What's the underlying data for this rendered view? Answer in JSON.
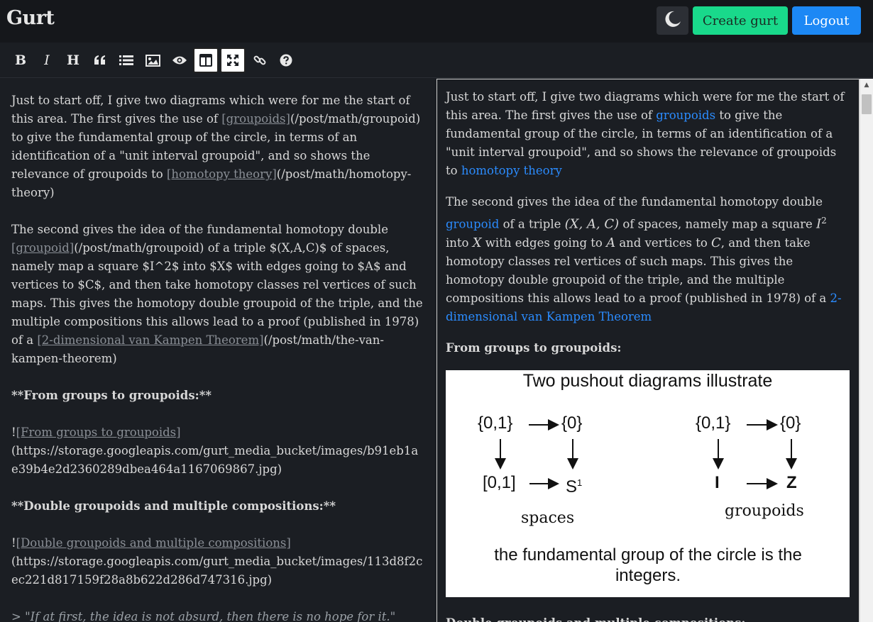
{
  "app": {
    "title": "Gurt"
  },
  "header": {
    "theme_icon": "moon-icon",
    "create_label": "Create gurt",
    "logout_label": "Logout",
    "colors": {
      "create": "#19d98b",
      "logout": "#1c88f5",
      "background": "#15171b"
    }
  },
  "toolbar": {
    "bold": "B",
    "italic": "I",
    "heading": "H",
    "items": [
      "bold",
      "italic",
      "heading",
      "quote",
      "unordered-list",
      "image",
      "preview",
      "side-by-side",
      "fullscreen",
      "link",
      "help"
    ],
    "active": [
      "side-by-side",
      "fullscreen"
    ]
  },
  "editor": {
    "p1_a": "Just to start off, I give two diagrams which were for me the start of this area. The first gives the use of ",
    "p1_link1": "[groupoids]",
    "p1_url1": "(/post/math/groupoid)",
    "p1_b": " to give the fundamental group of the circle, in terms of an identification of a \"unit interval groupoid\", and so shows the relevance of groupoids to ",
    "p1_link2": "[homotopy theory]",
    "p1_url2": "(/post/math/homotopy-theory)",
    "p2_a": "The second gives the idea of the fundamental homotopy double ",
    "p2_link1": "[groupoid]",
    "p2_url1": "(/post/math/groupoid)",
    "p2_b": " of a triple $(X,A,C)$ of spaces, namely map a square $I^2$ into $X$ with edges going to $A$ and vertices to $C$, and then take homotopy classes rel vertices of such maps. This gives the homotopy double groupoid of the triple, and the multiple compositions this allows lead to a proof (published in 1978) of a ",
    "p2_link2": "[2-dimensional van Kampen Theorem]",
    "p2_url2": "(/post/math/the-van-kampen-theorem)",
    "h1": "**From groups to groupoids:**",
    "img1_bang": "!",
    "img1_alt": "[From groups to groupoids]",
    "img1_url": "(https://storage.googleapis.com/gurt_media_bucket/images/b91eb1ae39b4e2d2360289dbea464a1167069867.jpg)",
    "h2": "**Double groupoids and multiple compositions:**",
    "img2_bang": "!",
    "img2_alt": "[Double groupoids and multiple compositions]",
    "img2_url": "(https://storage.googleapis.com/gurt_media_bucket/images/113d8f2cec221d817159f28a8b622d286d747316.jpg)",
    "quote": "> \"If at first, the idea is not absurd, then there is no hope for it.\" Albert Einstein"
  },
  "preview": {
    "p1_a": "Just to start off, I give two diagrams which were for me the start of this area. The first gives the use of ",
    "p1_link1": "groupoids",
    "p1_b": " to give the fundamental group of the circle, in terms of an identification of a \"unit interval groupoid\", and so shows the relevance of groupoids to ",
    "p1_link2": "homotopy theory",
    "p2_a": "The second gives the idea of the fundamental homotopy double ",
    "p2_link1": "groupoid",
    "p2_b": " of a triple ",
    "p2_math1": "(X, A, C)",
    "p2_c": " of spaces, namely map a square ",
    "p2_math2": "I",
    "p2_math2_sup": "2",
    "p2_d": " into ",
    "p2_math3": "X",
    "p2_e": " with edges going to ",
    "p2_math4": "A",
    "p2_f": " and vertices to ",
    "p2_math5": "C",
    "p2_g": ", and then take homotopy classes rel vertices of such maps. This gives the homotopy double groupoid of the triple, and the multiple compositions this allows lead to a proof (published in 1978) of a ",
    "p2_link2": "2-dimensional van Kampen Theorem",
    "h1": "From groups to groupoids:",
    "diagram": {
      "title": "Two pushout diagrams illustrate",
      "left_tl": "{0,1}",
      "left_tr": "{0}",
      "left_bl": "[0,1]",
      "left_br": "S",
      "left_br_sup": "1",
      "left_caption": "spaces",
      "right_tl": "{0,1}",
      "right_tr": "{0}",
      "right_bl": "I",
      "right_br": "Z",
      "right_caption": "groupoids",
      "footer": "the fundamental group of the circle is the integers."
    },
    "h2": "Double groupoids and multiple compositions:"
  }
}
